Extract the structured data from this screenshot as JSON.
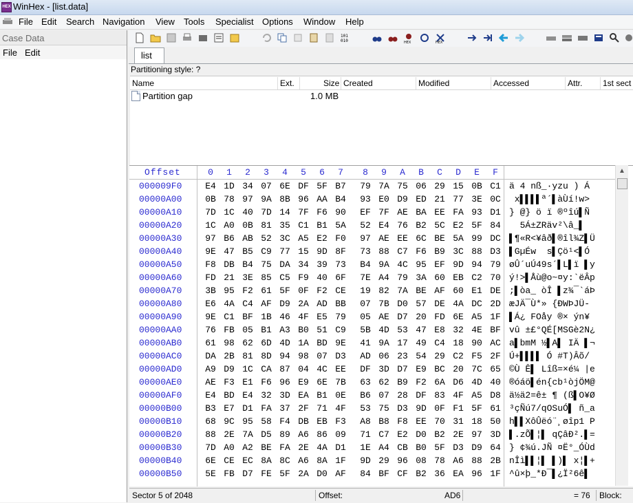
{
  "window": {
    "title": "WinHex - [list.data]"
  },
  "menu": [
    "File",
    "Edit",
    "Search",
    "Navigation",
    "View",
    "Tools",
    "Specialist",
    "Options",
    "Window",
    "Help"
  ],
  "case_panel": {
    "title": "Case Data",
    "menu": [
      "File",
      "Edit"
    ]
  },
  "tab": {
    "label": "list"
  },
  "partition_style": "Partitioning style: ?",
  "dir_columns": [
    "Name",
    "Ext.",
    "Size",
    "Created",
    "Modified",
    "Accessed",
    "Attr.",
    "1st sect"
  ],
  "dir_rows": [
    {
      "name": "Partition gap",
      "ext": "",
      "size": "1.0 MB"
    }
  ],
  "hex": {
    "offset_label": "Offset",
    "columns": [
      "0",
      "1",
      "2",
      "3",
      "4",
      "5",
      "6",
      "7",
      "8",
      "9",
      "A",
      "B",
      "C",
      "D",
      "E",
      "F"
    ],
    "rows": [
      {
        "off": "000009F0",
        "b": [
          "E4",
          "1D",
          "34",
          "07",
          "6E",
          "DF",
          "5F",
          "B7",
          "79",
          "7A",
          "75",
          "06",
          "29",
          "15",
          "0B",
          "C1"
        ],
        "a": "ä 4 nß_·yzu ) Á"
      },
      {
        "off": "00000A00",
        "b": [
          "0B",
          "78",
          "97",
          "9A",
          "8B",
          "96",
          "AA",
          "B4",
          "93",
          "E0",
          "D9",
          "ED",
          "21",
          "77",
          "3E",
          "0C"
        ],
        "a": " x▌▌▌▌ª´▌àÙí!w>"
      },
      {
        "off": "00000A10",
        "b": [
          "7D",
          "1C",
          "40",
          "7D",
          "14",
          "7F",
          "F6",
          "90",
          "EF",
          "7F",
          "AE",
          "BA",
          "EE",
          "FA",
          "93",
          "D1"
        ],
        "a": "} @} ö ï ®ºîú▌Ñ"
      },
      {
        "off": "00000A20",
        "b": [
          "1C",
          "A0",
          "0B",
          "81",
          "35",
          "C1",
          "B1",
          "5A",
          "52",
          "E4",
          "76",
          "B2",
          "5C",
          "E2",
          "5F",
          "84"
        ],
        "a": "  5Á±ZRäv²\\â_▌"
      },
      {
        "off": "00000A30",
        "b": [
          "97",
          "B6",
          "AB",
          "52",
          "3C",
          "A5",
          "E2",
          "F0",
          "97",
          "AE",
          "EE",
          "6C",
          "BE",
          "5A",
          "99",
          "DC"
        ],
        "a": "▌¶«R<¥âð▌®îl¾Z▌Ü"
      },
      {
        "off": "00000A40",
        "b": [
          "9E",
          "47",
          "B5",
          "C9",
          "77",
          "15",
          "9D",
          "8F",
          "73",
          "88",
          "C7",
          "F6",
          "B9",
          "3C",
          "88",
          "D3"
        ],
        "a": "▌GµÉw  s▌Çö¹<▌Ó"
      },
      {
        "off": "00000A50",
        "b": [
          "F8",
          "DB",
          "B4",
          "75",
          "DA",
          "34",
          "39",
          "73",
          "B4",
          "9A",
          "4C",
          "95",
          "EF",
          "9D",
          "94",
          "79"
        ],
        "a": "øÛ´uÚ49s´▌L▌ï ▌y"
      },
      {
        "off": "00000A60",
        "b": [
          "FD",
          "21",
          "3E",
          "85",
          "C5",
          "F9",
          "40",
          "6F",
          "7E",
          "A4",
          "79",
          "3A",
          "60",
          "EB",
          "C2",
          "70"
        ],
        "a": "ý!>▌Åù@o~¤y:`ëÂp"
      },
      {
        "off": "00000A70",
        "b": [
          "3B",
          "95",
          "F2",
          "61",
          "5F",
          "0F",
          "F2",
          "CE",
          "19",
          "82",
          "7A",
          "BE",
          "AF",
          "60",
          "E1",
          "DE"
        ],
        "a": ";▌òa_ òÎ ▌z¾¯`áÞ"
      },
      {
        "off": "00000A80",
        "b": [
          "E6",
          "4A",
          "C4",
          "AF",
          "D9",
          "2A",
          "AD",
          "BB",
          "07",
          "7B",
          "D0",
          "57",
          "DE",
          "4A",
          "DC",
          "2D"
        ],
        "a": "æJÄ¯Ù*­» {ÐWÞJÜ-"
      },
      {
        "off": "00000A90",
        "b": [
          "9E",
          "C1",
          "BF",
          "1B",
          "46",
          "4F",
          "E5",
          "79",
          "05",
          "AE",
          "D7",
          "20",
          "FD",
          "6E",
          "A5",
          "1F"
        ],
        "a": "▌Á¿ FOåy ®× ýn¥"
      },
      {
        "off": "00000AA0",
        "b": [
          "76",
          "FB",
          "05",
          "B1",
          "A3",
          "B0",
          "51",
          "C9",
          "5B",
          "4D",
          "53",
          "47",
          "E8",
          "32",
          "4E",
          "BF"
        ],
        "a": "vû ±£°QÉ[MSGè2N¿"
      },
      {
        "off": "00000AB0",
        "b": [
          "61",
          "98",
          "62",
          "6D",
          "4D",
          "1A",
          "BD",
          "9E",
          "41",
          "9A",
          "17",
          "49",
          "C4",
          "18",
          "90",
          "AC"
        ],
        "a": "a▌bmM ½▌A▌ IÄ ▌¬"
      },
      {
        "off": "00000AC0",
        "b": [
          "DA",
          "2B",
          "81",
          "8D",
          "94",
          "98",
          "07",
          "D3",
          "AD",
          "06",
          "23",
          "54",
          "29",
          "C2",
          "F5",
          "2F"
        ],
        "a": "Ú+▌▌▌▌ Ó­ #T)Âõ/"
      },
      {
        "off": "00000AD0",
        "b": [
          "A9",
          "D9",
          "1C",
          "CA",
          "87",
          "04",
          "4C",
          "EE",
          "DF",
          "3D",
          "D7",
          "E9",
          "BC",
          "20",
          "7C",
          "65"
        ],
        "a": "©Ù Ê▌ Lîß=×é¼ |e"
      },
      {
        "off": "00000AE0",
        "b": [
          "AE",
          "F3",
          "E1",
          "F6",
          "96",
          "E9",
          "6E",
          "7B",
          "63",
          "62",
          "B9",
          "F2",
          "6A",
          "D6",
          "4D",
          "40"
        ],
        "a": "®óáö▌én{cb¹òjÖM@"
      },
      {
        "off": "00000AF0",
        "b": [
          "E4",
          "BD",
          "E4",
          "32",
          "3D",
          "EA",
          "B1",
          "0E",
          "B6",
          "07",
          "28",
          "DF",
          "83",
          "4F",
          "A5",
          "D8"
        ],
        "a": "ä½ä2=ê± ¶ (ß▌O¥Ø"
      },
      {
        "off": "00000B00",
        "b": [
          "B3",
          "E7",
          "D1",
          "FA",
          "37",
          "2F",
          "71",
          "4F",
          "53",
          "75",
          "D3",
          "9D",
          "0F",
          "F1",
          "5F",
          "61"
        ],
        "a": "³çÑú7/qOSuÓ▌ ñ_a"
      },
      {
        "off": "00000B10",
        "b": [
          "68",
          "9C",
          "95",
          "58",
          "F4",
          "DB",
          "EB",
          "F3",
          "A8",
          "B8",
          "F8",
          "EE",
          "70",
          "31",
          "18",
          "50"
        ],
        "a": "h▌▌XôÛëó¨¸øîp1 P"
      },
      {
        "off": "00000B20",
        "b": [
          "88",
          "2E",
          "7A",
          "D5",
          "89",
          "A6",
          "86",
          "09",
          "71",
          "C7",
          "E2",
          "D0",
          "B2",
          "2E",
          "97",
          "3D"
        ],
        "a": "▌.zÕ▌¦▌ qÇâÐ².▌="
      },
      {
        "off": "00000B30",
        "b": [
          "7D",
          "A0",
          "A2",
          "BE",
          "FA",
          "2E",
          "4A",
          "D1",
          "1E",
          "A4",
          "CB",
          "B0",
          "5F",
          "D3",
          "D9",
          "64"
        ],
        "a": "} ¢¾ú.JÑ ¤Ë°_ÓÙd"
      },
      {
        "off": "00000B40",
        "b": [
          "6E",
          "CE",
          "EC",
          "8A",
          "8C",
          "A6",
          "8A",
          "1F",
          "9D",
          "29",
          "96",
          "08",
          "78",
          "A6",
          "88",
          "2B"
        ],
        "a": "nÎì▌▌¦▌ ▌)▌ x¦▌+"
      },
      {
        "off": "00000B50",
        "b": [
          "5E",
          "FB",
          "D7",
          "FE",
          "5F",
          "2A",
          "D0",
          "AF",
          "84",
          "BF",
          "CF",
          "B2",
          "36",
          "EA",
          "96",
          "1F"
        ],
        "a": "^û×þ_*Ð¯▌¿Ï²6ê▌"
      }
    ]
  },
  "status": {
    "sector": "Sector 5 of 2048",
    "offset_label": "Offset:",
    "offset_value": "AD6",
    "value": "= 76",
    "block_label": "Block:"
  }
}
